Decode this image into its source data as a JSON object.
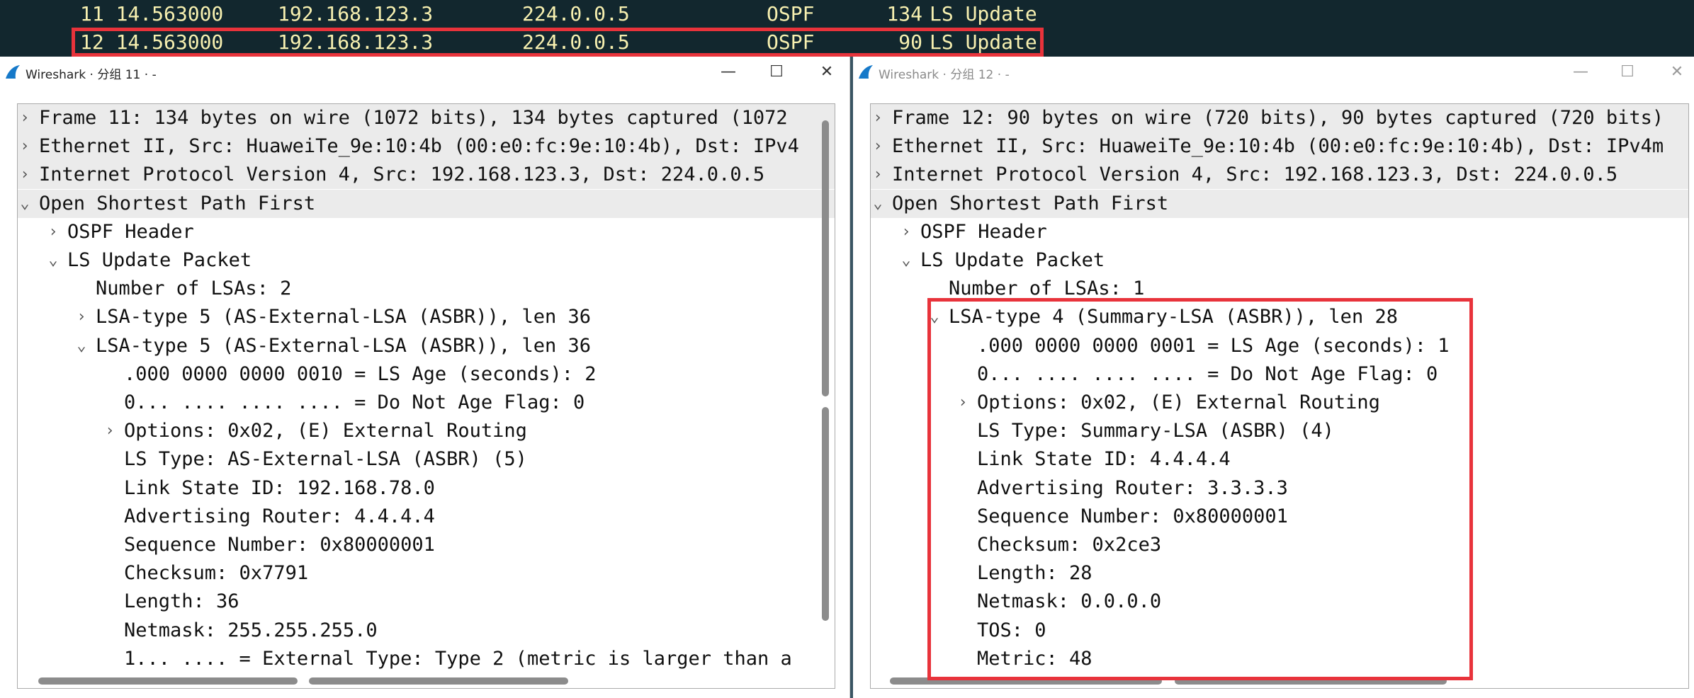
{
  "packet_list": {
    "rows": [
      {
        "no_time": "11 14.563000",
        "source": "192.168.123.3",
        "destination": "224.0.0.5",
        "protocol": "OSPF",
        "length": "134",
        "info": "LS Update"
      },
      {
        "no_time": "12 14.563000",
        "source": "192.168.123.3",
        "destination": "224.0.0.5",
        "protocol": "OSPF",
        "length": "90",
        "info": "LS Update"
      }
    ],
    "selected_color": "#e8333b"
  },
  "left_window": {
    "title": "Wireshark · 分组 11 · -",
    "buttons": {
      "minimize": "—",
      "maximize": "☐",
      "close": "✕"
    },
    "tree": [
      {
        "arrow": "›",
        "text": "Frame 11: 134 bytes on wire (1072 bits), 134 bytes captured (1072"
      },
      {
        "arrow": "›",
        "text": "Ethernet II, Src: HuaweiTe_9e:10:4b (00:e0:fc:9e:10:4b), Dst: IPv4"
      },
      {
        "arrow": "›",
        "text": "Internet Protocol Version 4, Src: 192.168.123.3, Dst: 224.0.0.5"
      },
      {
        "arrow": "⌄",
        "text": "Open Shortest Path First"
      },
      {
        "arrow": "›",
        "text": "OSPF Header"
      },
      {
        "arrow": "⌄",
        "text": "LS Update Packet"
      },
      {
        "arrow": "",
        "text": "Number of LSAs: 2"
      },
      {
        "arrow": "›",
        "text": "LSA-type 5 (AS-External-LSA (ASBR)), len 36"
      },
      {
        "arrow": "⌄",
        "text": "LSA-type 5 (AS-External-LSA (ASBR)), len 36"
      },
      {
        "arrow": "",
        "text": ".000 0000 0000 0010 = LS Age (seconds): 2"
      },
      {
        "arrow": "",
        "text": "0... .... .... .... = Do Not Age Flag: 0"
      },
      {
        "arrow": "›",
        "text": "Options: 0x02, (E) External Routing"
      },
      {
        "arrow": "",
        "text": "LS Type: AS-External-LSA (ASBR) (5)"
      },
      {
        "arrow": "",
        "text": "Link State ID: 192.168.78.0"
      },
      {
        "arrow": "",
        "text": "Advertising Router: 4.4.4.4"
      },
      {
        "arrow": "",
        "text": "Sequence Number: 0x80000001"
      },
      {
        "arrow": "",
        "text": "Checksum: 0x7791"
      },
      {
        "arrow": "",
        "text": "Length: 36"
      },
      {
        "arrow": "",
        "text": "Netmask: 255.255.255.0"
      },
      {
        "arrow": "",
        "text": "1... .... = External Type: Type 2 (metric is larger than a"
      }
    ]
  },
  "right_window": {
    "title": "Wireshark · 分组 12 · -",
    "buttons": {
      "minimize": "—",
      "maximize": "☐",
      "close": "✕"
    },
    "tree": [
      {
        "arrow": "›",
        "text": "Frame 12: 90 bytes on wire (720 bits), 90 bytes captured (720 bits)"
      },
      {
        "arrow": "›",
        "text": "Ethernet II, Src: HuaweiTe_9e:10:4b (00:e0:fc:9e:10:4b), Dst: IPv4m"
      },
      {
        "arrow": "›",
        "text": "Internet Protocol Version 4, Src: 192.168.123.3, Dst: 224.0.0.5"
      },
      {
        "arrow": "⌄",
        "text": "Open Shortest Path First"
      },
      {
        "arrow": "›",
        "text": "OSPF Header"
      },
      {
        "arrow": "⌄",
        "text": "LS Update Packet"
      },
      {
        "arrow": "",
        "text": "Number of LSAs: 1"
      },
      {
        "arrow": "⌄",
        "text": "LSA-type 4 (Summary-LSA (ASBR)), len 28"
      },
      {
        "arrow": "",
        "text": ".000 0000 0000 0001 = LS Age (seconds): 1"
      },
      {
        "arrow": "",
        "text": "0... .... .... .... = Do Not Age Flag: 0"
      },
      {
        "arrow": "›",
        "text": "Options: 0x02, (E) External Routing"
      },
      {
        "arrow": "",
        "text": "LS Type: Summary-LSA (ASBR) (4)"
      },
      {
        "arrow": "",
        "text": "Link State ID: 4.4.4.4"
      },
      {
        "arrow": "",
        "text": "Advertising Router: 3.3.3.3"
      },
      {
        "arrow": "",
        "text": "Sequence Number: 0x80000001"
      },
      {
        "arrow": "",
        "text": "Checksum: 0x2ce3"
      },
      {
        "arrow": "",
        "text": "Length: 28"
      },
      {
        "arrow": "",
        "text": "Netmask: 0.0.0.0"
      },
      {
        "arrow": "",
        "text": "TOS: 0"
      },
      {
        "arrow": "",
        "text": "Metric: 48"
      }
    ]
  },
  "colors": {
    "highlight": "#e8333b",
    "packet_list_bg": "#12272e",
    "packet_text": "#f7f0b0",
    "shaded_row": "#ebebeb"
  }
}
